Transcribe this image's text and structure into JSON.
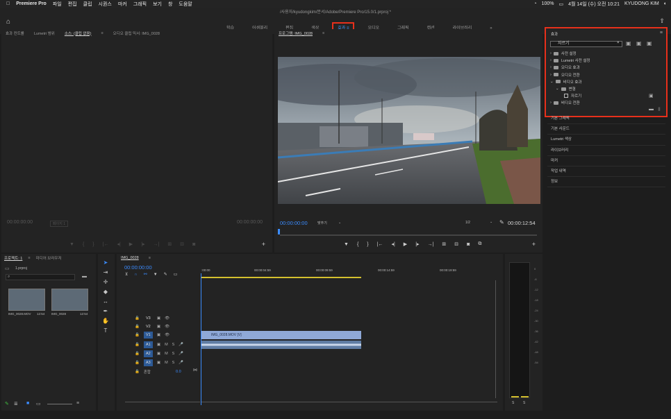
{
  "menubar": {
    "app": "Premiere Pro",
    "items": [
      "파일",
      "편집",
      "클립",
      "시퀀스",
      "마커",
      "그래픽",
      "보기",
      "창",
      "도움말"
    ],
    "battery": "100%",
    "datetime": "4월 14일 (수) 오전 10:21",
    "user": "KYUDONG KIM"
  },
  "window": {
    "path": "/사용자/kyudongkim/문서/Adobe/Premiere Pro/15.0/1.prproj *"
  },
  "workspaces": [
    "학습",
    "어셈블리",
    "편집",
    "색상",
    "효과",
    "오디오",
    "그래픽",
    "캡션",
    "라이브러리"
  ],
  "source_panel": {
    "tabs": [
      "효과 컨트롤",
      "Lumetri 범위",
      "소스: (클립 없음)",
      "오디오 클립 믹서: IMG_0028"
    ],
    "tc_left": "00:00:00:00",
    "tc_right": "00:00:00:00",
    "fit": "페이지 1"
  },
  "program_panel": {
    "title": "프로그램: IMG_0028",
    "tc_current": "00:00:00:00",
    "fit": "맞추기",
    "res": "1/2",
    "tc_duration": "00:00:12:54"
  },
  "effects_panel": {
    "title": "효과",
    "search": "자르기",
    "tree": [
      {
        "label": "사전 설정",
        "indent": 0
      },
      {
        "label": "Lumetri 사전 설정",
        "indent": 0
      },
      {
        "label": "오디오 효과",
        "indent": 0
      },
      {
        "label": "오디오 전환",
        "indent": 0
      },
      {
        "label": "비디오 효과",
        "indent": 0
      },
      {
        "label": "변형",
        "indent": 1
      },
      {
        "label": "자르기",
        "indent": 2
      },
      {
        "label": "비디오 전환",
        "indent": 0
      }
    ]
  },
  "side_panels": [
    "기본 그래픽",
    "기본 사운드",
    "Lumetri 색상",
    "라이브러리",
    "마커",
    "작업 내역",
    "정보"
  ],
  "project_panel": {
    "tabs": [
      "프로젝트: 1",
      "미디어 브라우저"
    ],
    "project_file": "1.prproj",
    "items": [
      {
        "name": "IMG_0028.MOV",
        "dur": "12:54"
      },
      {
        "name": "IMG_0028",
        "dur": "12:54"
      }
    ]
  },
  "timeline": {
    "tab": "IMG_0028",
    "tc": "00:00:00:00",
    "ruler": [
      ":00:00",
      "00:00:04:59",
      "00:00:09:59",
      "00:00:14:59",
      "00:00:19:59"
    ],
    "tracks_video": [
      "V3",
      "V2",
      "V1"
    ],
    "tracks_audio": [
      "A1",
      "A2",
      "A3"
    ],
    "mix_label": "혼합",
    "mix_value": "0.0",
    "clip_name": "IMG_0028.MOV [V]"
  },
  "meter": {
    "labels": [
      "0",
      "-6",
      "-12",
      "-18",
      "-24",
      "-30",
      "-36",
      "-42",
      "-48",
      "-54"
    ],
    "solo": [
      "S",
      "S"
    ]
  }
}
